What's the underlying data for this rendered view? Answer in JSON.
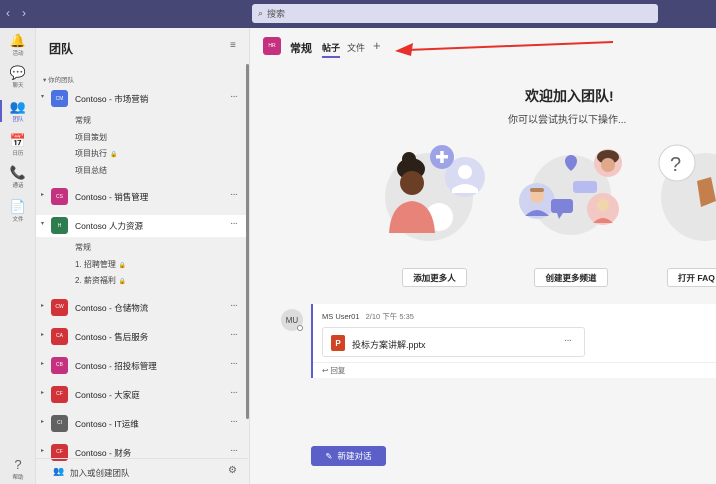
{
  "search": {
    "placeholder": "搜索"
  },
  "rail": [
    {
      "icon": "bell-icon",
      "glyph": "🔔",
      "label": "活动"
    },
    {
      "icon": "chat-icon",
      "glyph": "💬",
      "label": "聊天"
    },
    {
      "icon": "teams-icon",
      "glyph": "👥",
      "label": "团队"
    },
    {
      "icon": "calendar-icon",
      "glyph": "📅",
      "label": "日历"
    },
    {
      "icon": "phone-icon",
      "glyph": "📞",
      "label": "通话"
    },
    {
      "icon": "files-icon",
      "glyph": "📄",
      "label": "文件"
    },
    {
      "icon": "help-icon",
      "glyph": "?",
      "label": "帮助"
    }
  ],
  "panel": {
    "title": "团队",
    "section_label": "你的团队",
    "footer_label": "加入或创建团队"
  },
  "teams": [
    {
      "name": "Contoso - 市场营销",
      "avatar": "CM",
      "color": "#4a72e0",
      "expanded": true,
      "channels": [
        {
          "name": "常规"
        },
        {
          "name": "项目策划"
        },
        {
          "name": "项目执行",
          "private": true
        },
        {
          "name": "项目总结"
        }
      ]
    },
    {
      "name": "Contoso - 销售管理",
      "avatar": "CS",
      "color": "#c4317f"
    },
    {
      "name": "Contoso 人力资源",
      "avatar": "H",
      "color": "#2e7d4f",
      "expanded": true,
      "selected": true,
      "channels": [
        {
          "name": "常规"
        },
        {
          "name": "1. 招聘管理",
          "private": true
        },
        {
          "name": "2. 薪资福利",
          "private": true
        }
      ]
    },
    {
      "name": "Contoso - 仓储物流",
      "avatar": "CW",
      "color": "#d13438"
    },
    {
      "name": "Contoso - 售后服务",
      "avatar": "CA",
      "color": "#d13438"
    },
    {
      "name": "Contoso - 招投标管理",
      "avatar": "CB",
      "color": "#c4317f"
    },
    {
      "name": "Contoso - 大家庭",
      "avatar": "CF",
      "color": "#d13438"
    },
    {
      "name": "Contoso - IT运维",
      "avatar": "CI",
      "color": "#616161"
    },
    {
      "name": "Contoso - 财务",
      "avatar": "CF",
      "color": "#d13438"
    }
  ],
  "channel_header": {
    "avatar": "HR",
    "title": "常规",
    "tabs": [
      {
        "label": "帖子",
        "active": true
      },
      {
        "label": "文件",
        "active": false
      }
    ],
    "add_tab": "+"
  },
  "welcome": {
    "title": "欢迎加入团队!",
    "subtitle": "你可以尝试执行以下操作...",
    "actions": [
      "添加更多人",
      "创建更多频道",
      "打开 FAQ"
    ]
  },
  "post": {
    "avatar_initials": "MU",
    "author": "MS User01",
    "time": "2/10 下午 5:35",
    "file_name": "投标方案讲解.pptx",
    "reply_label": "回复"
  },
  "new_conversation": {
    "label": "新建对话"
  },
  "colors": {
    "accent": "#5b5fc7",
    "topbar": "#464775",
    "annotation": "#e8302a"
  }
}
